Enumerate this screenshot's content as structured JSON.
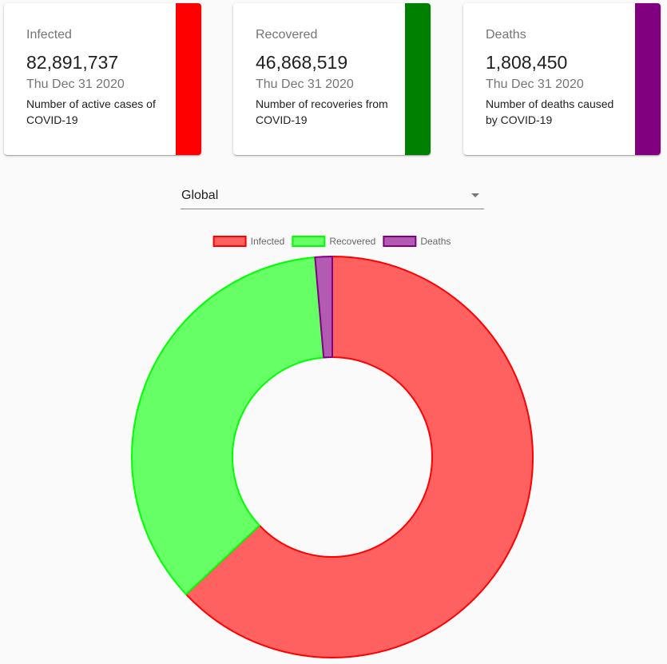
{
  "cards": [
    {
      "title": "Infected",
      "value": "82,891,737",
      "date": "Thu Dec 31 2020",
      "description": "Number of active cases of COVID-19",
      "accent_color": "#ff0000"
    },
    {
      "title": "Recovered",
      "value": "46,868,519",
      "date": "Thu Dec 31 2020",
      "description": "Number of recoveries from COVID-19",
      "accent_color": "#008000"
    },
    {
      "title": "Deaths",
      "value": "1,808,450",
      "date": "Thu Dec 31 2020",
      "description": "Number of deaths caused by COVID-19",
      "accent_color": "#800080"
    }
  ],
  "country_select": {
    "value": "Global"
  },
  "chart_data": {
    "type": "pie",
    "variant": "doughnut",
    "title": "",
    "categories": [
      "Infected",
      "Recovered",
      "Deaths"
    ],
    "values": [
      82891737,
      46868519,
      1808450
    ],
    "colors": {
      "fill": [
        "#ff6060",
        "#66ff66",
        "#b35bb3"
      ],
      "border": [
        "#ff0000",
        "#00ff00",
        "#800080"
      ]
    },
    "legend": "top",
    "start_angle": "top",
    "direction": "clockwise"
  }
}
